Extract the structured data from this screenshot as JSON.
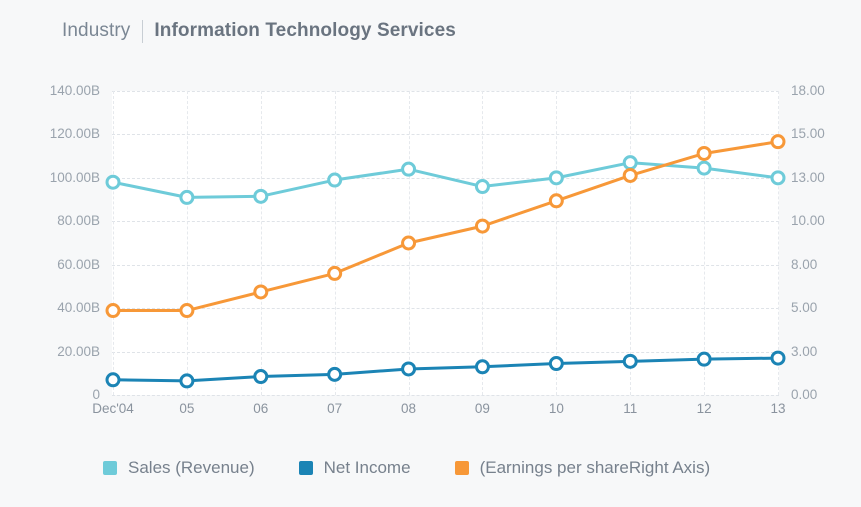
{
  "header": {
    "category_label": "Industry",
    "divider": "|",
    "title": "Information Technology Services"
  },
  "colors": {
    "sales": "#6ecbd9",
    "net_income": "#1b84b5",
    "eps": "#f79838",
    "grid": "#dfe3e8",
    "plot_background": "#ffffff",
    "page_background": "#f7f8f9",
    "axis_text": "#9aa3ad",
    "title_text": "#6a7480"
  },
  "axes": {
    "left_ticks": [
      "0",
      "20.00B",
      "40.00B",
      "60.00B",
      "80.00B",
      "100.00B",
      "120.00B",
      "140.00B"
    ],
    "left_tick_values": [
      0,
      20,
      40,
      60,
      80,
      100,
      120,
      140
    ],
    "right_ticks": [
      "0.00",
      "3.00",
      "5.00",
      "8.00",
      "10.00",
      "13.00",
      "15.00",
      "18.00"
    ],
    "right_tick_values": [
      0.0,
      3.0,
      5.0,
      8.0,
      10.0,
      13.0,
      15.0,
      18.0
    ],
    "x_ticks": [
      "Dec'04",
      "05",
      "06",
      "07",
      "08",
      "09",
      "10",
      "11",
      "12",
      "13"
    ]
  },
  "legend": {
    "position": "bottom",
    "items": [
      {
        "label": "Sales (Revenue)",
        "color": "#6ecbd9"
      },
      {
        "label": "Net Income",
        "color": "#1b84b5"
      },
      {
        "label": "(Earnings per shareRight Axis)",
        "color": "#f79838"
      }
    ]
  },
  "chart_data": {
    "type": "line",
    "title": "Information Technology Services",
    "xlabel": "",
    "ylabel": "",
    "grid": true,
    "legend_position": "bottom",
    "categories": [
      "Dec'04",
      "05",
      "06",
      "07",
      "08",
      "09",
      "10",
      "11",
      "12",
      "13"
    ],
    "left_axis": {
      "label": "",
      "ylim": [
        0,
        140
      ],
      "ticks": [
        0,
        20,
        40,
        60,
        80,
        100,
        120,
        140
      ],
      "tick_labels": [
        "0",
        "20.00B",
        "40.00B",
        "60.00B",
        "80.00B",
        "100.00B",
        "120.00B",
        "140.00B"
      ]
    },
    "right_axis": {
      "label": "Right Axis",
      "ylim": [
        0,
        18
      ],
      "ticks": [
        0.0,
        3.0,
        5.0,
        8.0,
        10.0,
        13.0,
        15.0,
        18.0
      ],
      "tick_labels": [
        "0.00",
        "3.00",
        "5.00",
        "8.00",
        "10.00",
        "13.00",
        "15.00",
        "18.00"
      ]
    },
    "series": [
      {
        "name": "Sales (Revenue)",
        "axis": "left",
        "color": "#6ecbd9",
        "unit": "B",
        "values": [
          98.0,
          91.0,
          91.5,
          99.0,
          104.0,
          96.0,
          100.0,
          107.0,
          104.5,
          100.0
        ]
      },
      {
        "name": "Net Income",
        "axis": "left",
        "color": "#1b84b5",
        "unit": "B",
        "values": [
          7.0,
          6.5,
          8.5,
          9.5,
          12.0,
          13.0,
          14.5,
          15.5,
          16.5,
          17.0
        ]
      },
      {
        "name": "(Earnings per shareRight Axis)",
        "axis": "right",
        "color": "#f79838",
        "unit": "",
        "values": [
          5.0,
          5.0,
          6.1,
          7.2,
          9.0,
          10.0,
          11.5,
          13.0,
          14.3,
          15.0
        ]
      }
    ]
  }
}
